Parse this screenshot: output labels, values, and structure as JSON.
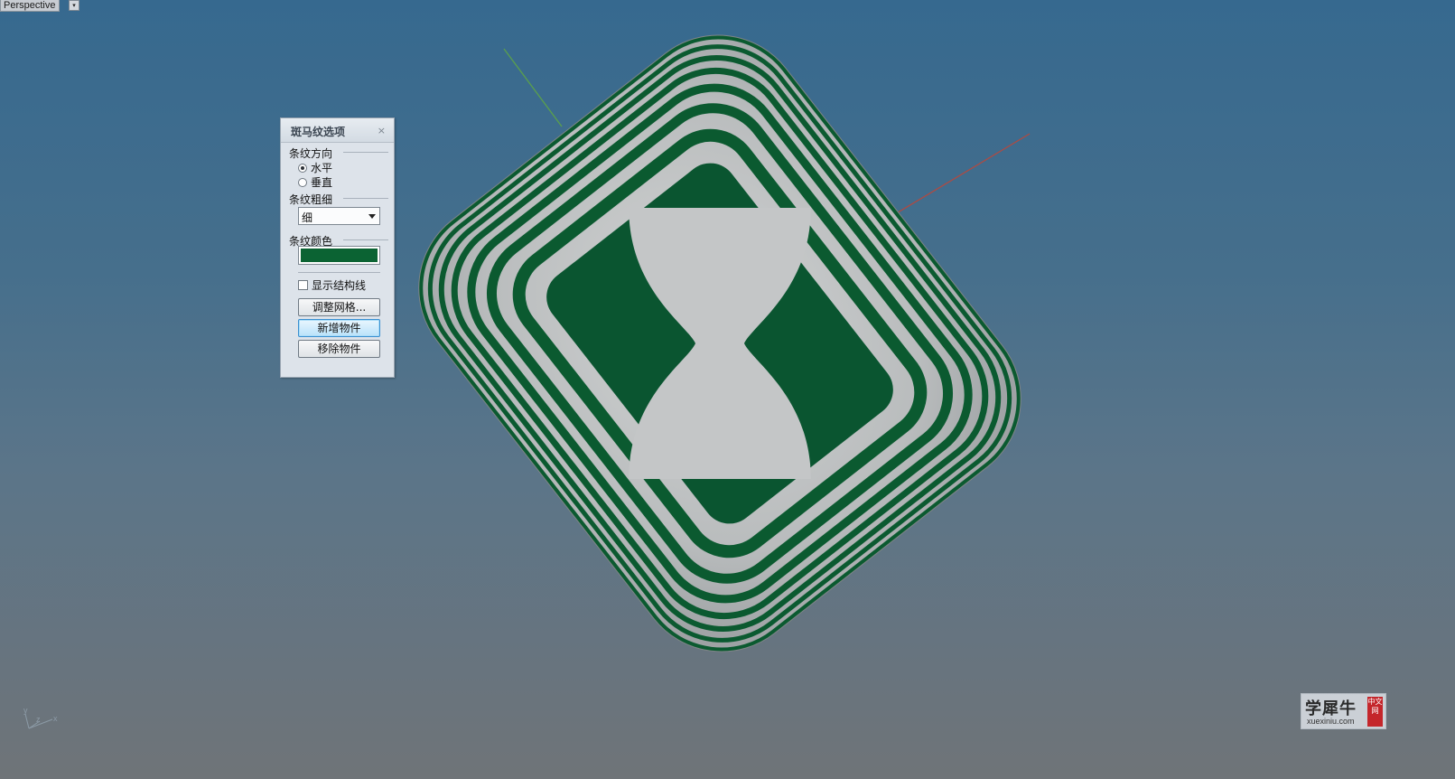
{
  "viewport": {
    "name": "Perspective",
    "menu_glyph": "▾",
    "axis_labels": {
      "x": "x",
      "y": "y",
      "z": "z"
    }
  },
  "zebra_dialog": {
    "title": "斑马纹选项",
    "close_glyph": "×",
    "direction": {
      "label": "条纹方向",
      "options": [
        {
          "label": "水平",
          "selected": true
        },
        {
          "label": "垂直",
          "selected": false
        }
      ]
    },
    "thickness": {
      "label": "条纹粗细",
      "value": "细"
    },
    "color": {
      "label": "条纹颜色",
      "value": "#0b6333"
    },
    "show_structure_lines": {
      "label": "显示结构线",
      "checked": false
    },
    "buttons": {
      "adjust_mesh": "调整网格...",
      "add_objects": "新增物件",
      "remove_objects": "移除物件"
    }
  },
  "colors": {
    "stripe": "#0b5a30",
    "surface_light": "#c9cbcb",
    "axis_x": "#b04a42",
    "axis_y": "#5aa04c"
  },
  "watermark": {
    "main": "学犀牛",
    "url": "xuexiniu.com",
    "tag": "中文网"
  }
}
